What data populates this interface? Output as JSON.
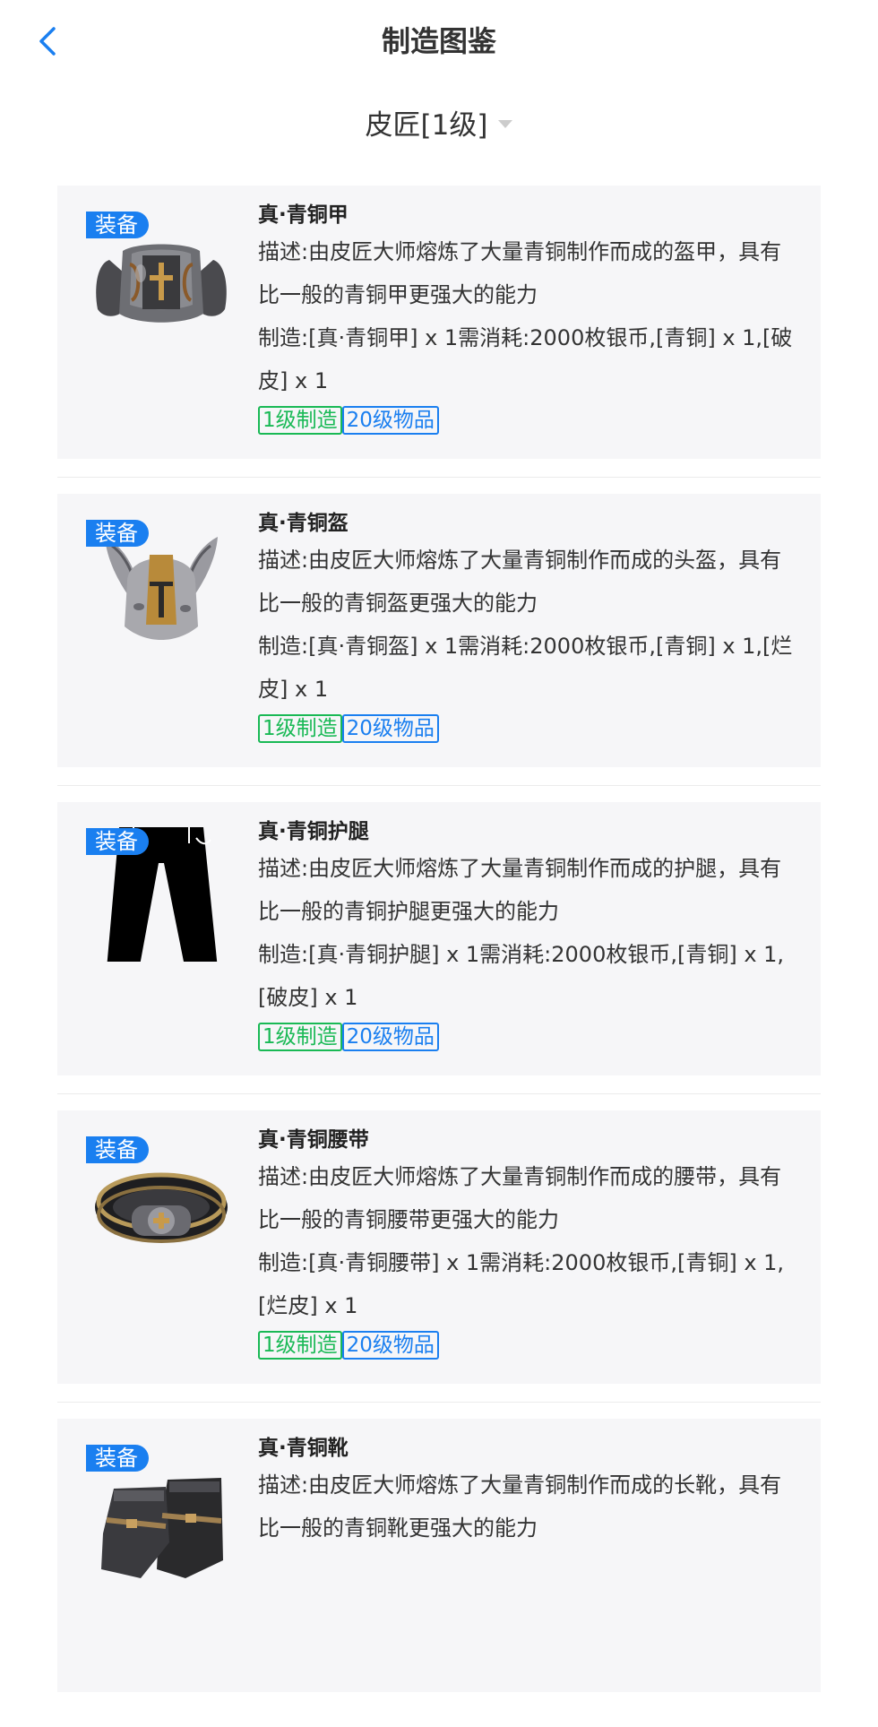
{
  "header": {
    "title": "制造图鉴"
  },
  "category": {
    "label": "皮匠[1级]"
  },
  "items": [
    {
      "badge": "装备",
      "name": "真·青铜甲",
      "desc": "描述:由皮匠大师熔炼了大量青铜制作而成的盔甲，具有比一般的青铜甲更强大的能力",
      "recipe": "制造:[真·青铜甲] x 1需消耗:2000枚银币,[青铜] x 1,[破皮] x 1",
      "tag_craft": "1级制造",
      "tag_level": "20级物品",
      "icon": "armor-icon"
    },
    {
      "badge": "装备",
      "name": "真·青铜盔",
      "desc": "描述:由皮匠大师熔炼了大量青铜制作而成的头盔，具有比一般的青铜盔更强大的能力",
      "recipe": "制造:[真·青铜盔] x 1需消耗:2000枚银币,[青铜] x 1,[烂皮] x 1",
      "tag_craft": "1级制造",
      "tag_level": "20级物品",
      "icon": "helmet-icon"
    },
    {
      "badge": "装备",
      "name": "真·青铜护腿",
      "desc": "描述:由皮匠大师熔炼了大量青铜制作而成的护腿，具有比一般的青铜护腿更强大的能力",
      "recipe": "制造:[真·青铜护腿] x 1需消耗:2000枚银币,[青铜] x 1,[破皮] x 1",
      "tag_craft": "1级制造",
      "tag_level": "20级物品",
      "icon": "leggings-icon"
    },
    {
      "badge": "装备",
      "name": "真·青铜腰带",
      "desc": "描述:由皮匠大师熔炼了大量青铜制作而成的腰带，具有比一般的青铜腰带更强大的能力",
      "recipe": "制造:[真·青铜腰带] x 1需消耗:2000枚银币,[青铜] x 1,[烂皮] x 1",
      "tag_craft": "1级制造",
      "tag_level": "20级物品",
      "icon": "belt-icon"
    },
    {
      "badge": "装备",
      "name": "真·青铜靴",
      "desc": "描述:由皮匠大师熔炼了大量青铜制作而成的长靴，具有比一般的青铜靴更强大的能力",
      "recipe": "",
      "tag_craft": "",
      "tag_level": "",
      "icon": "boots-icon"
    }
  ]
}
